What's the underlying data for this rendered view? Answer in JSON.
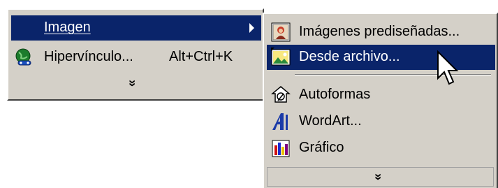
{
  "menu_left": {
    "items": [
      {
        "label": "Imagen",
        "has_submenu": true,
        "highlighted": true
      },
      {
        "label": "Hipervínculo...",
        "shortcut": "Alt+Ctrl+K",
        "icon": "globe-link-icon"
      }
    ],
    "expand_chevron": "»"
  },
  "menu_imagen": {
    "items": [
      {
        "label": "Imágenes prediseñadas...",
        "icon": "clip-art-icon"
      },
      {
        "label": "Desde archivo...",
        "icon": "picture-from-file-icon",
        "highlighted": true
      },
      {
        "label": "Autoformas",
        "icon": "autoshapes-icon"
      },
      {
        "label": "WordArt...",
        "icon": "wordart-icon"
      },
      {
        "label": "Gráfico",
        "icon": "chart-icon"
      }
    ],
    "expand_chevron": "»"
  },
  "colors": {
    "menu_bg": "#d4d0c8",
    "highlight_bg": "#0a246a",
    "highlight_fg": "#ffffff"
  }
}
